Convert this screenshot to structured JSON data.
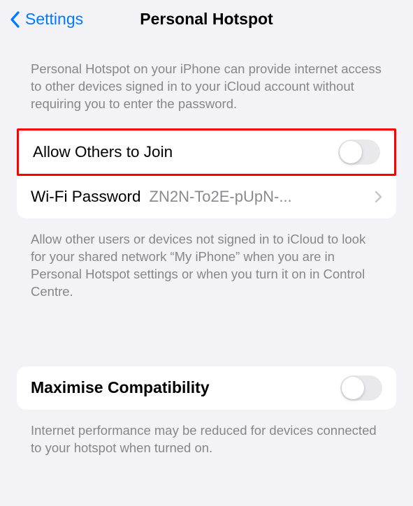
{
  "header": {
    "back_label": "Settings",
    "title": "Personal Hotspot"
  },
  "intro_text": "Personal Hotspot on your iPhone can provide internet access to other devices signed in to your iCloud account without requiring you to enter the password.",
  "allow_others": {
    "label": "Allow Others to Join"
  },
  "wifi_password": {
    "label": "Wi-Fi Password",
    "value": "ZN2N-To2E-pUpN-..."
  },
  "allow_others_footer": "Allow other users or devices not signed in to iCloud to look for your shared network “My iPhone” when you are in Personal Hotspot settings or when you turn it on in Control Centre.",
  "compat": {
    "label": "Maximise Compatibility"
  },
  "compat_footer": "Internet performance may be reduced for devices connected to your hotspot when turned on."
}
